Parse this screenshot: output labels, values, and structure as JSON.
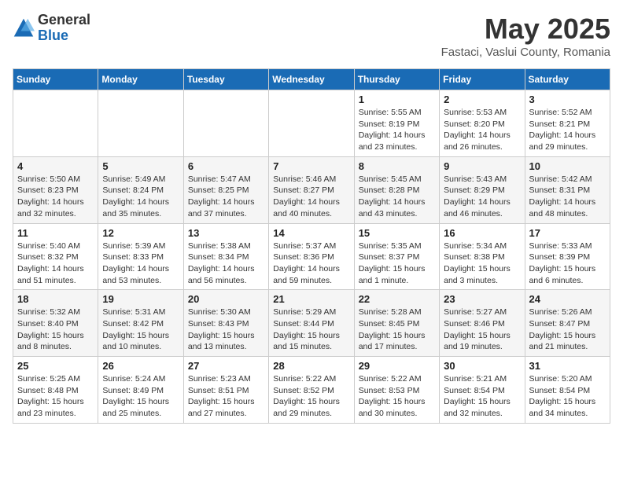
{
  "header": {
    "logo_general": "General",
    "logo_blue": "Blue",
    "month_title": "May 2025",
    "location": "Fastaci, Vaslui County, Romania"
  },
  "weekdays": [
    "Sunday",
    "Monday",
    "Tuesday",
    "Wednesday",
    "Thursday",
    "Friday",
    "Saturday"
  ],
  "weeks": [
    [
      {
        "num": "",
        "info": ""
      },
      {
        "num": "",
        "info": ""
      },
      {
        "num": "",
        "info": ""
      },
      {
        "num": "",
        "info": ""
      },
      {
        "num": "1",
        "info": "Sunrise: 5:55 AM\nSunset: 8:19 PM\nDaylight: 14 hours\nand 23 minutes."
      },
      {
        "num": "2",
        "info": "Sunrise: 5:53 AM\nSunset: 8:20 PM\nDaylight: 14 hours\nand 26 minutes."
      },
      {
        "num": "3",
        "info": "Sunrise: 5:52 AM\nSunset: 8:21 PM\nDaylight: 14 hours\nand 29 minutes."
      }
    ],
    [
      {
        "num": "4",
        "info": "Sunrise: 5:50 AM\nSunset: 8:23 PM\nDaylight: 14 hours\nand 32 minutes."
      },
      {
        "num": "5",
        "info": "Sunrise: 5:49 AM\nSunset: 8:24 PM\nDaylight: 14 hours\nand 35 minutes."
      },
      {
        "num": "6",
        "info": "Sunrise: 5:47 AM\nSunset: 8:25 PM\nDaylight: 14 hours\nand 37 minutes."
      },
      {
        "num": "7",
        "info": "Sunrise: 5:46 AM\nSunset: 8:27 PM\nDaylight: 14 hours\nand 40 minutes."
      },
      {
        "num": "8",
        "info": "Sunrise: 5:45 AM\nSunset: 8:28 PM\nDaylight: 14 hours\nand 43 minutes."
      },
      {
        "num": "9",
        "info": "Sunrise: 5:43 AM\nSunset: 8:29 PM\nDaylight: 14 hours\nand 46 minutes."
      },
      {
        "num": "10",
        "info": "Sunrise: 5:42 AM\nSunset: 8:31 PM\nDaylight: 14 hours\nand 48 minutes."
      }
    ],
    [
      {
        "num": "11",
        "info": "Sunrise: 5:40 AM\nSunset: 8:32 PM\nDaylight: 14 hours\nand 51 minutes."
      },
      {
        "num": "12",
        "info": "Sunrise: 5:39 AM\nSunset: 8:33 PM\nDaylight: 14 hours\nand 53 minutes."
      },
      {
        "num": "13",
        "info": "Sunrise: 5:38 AM\nSunset: 8:34 PM\nDaylight: 14 hours\nand 56 minutes."
      },
      {
        "num": "14",
        "info": "Sunrise: 5:37 AM\nSunset: 8:36 PM\nDaylight: 14 hours\nand 59 minutes."
      },
      {
        "num": "15",
        "info": "Sunrise: 5:35 AM\nSunset: 8:37 PM\nDaylight: 15 hours\nand 1 minute."
      },
      {
        "num": "16",
        "info": "Sunrise: 5:34 AM\nSunset: 8:38 PM\nDaylight: 15 hours\nand 3 minutes."
      },
      {
        "num": "17",
        "info": "Sunrise: 5:33 AM\nSunset: 8:39 PM\nDaylight: 15 hours\nand 6 minutes."
      }
    ],
    [
      {
        "num": "18",
        "info": "Sunrise: 5:32 AM\nSunset: 8:40 PM\nDaylight: 15 hours\nand 8 minutes."
      },
      {
        "num": "19",
        "info": "Sunrise: 5:31 AM\nSunset: 8:42 PM\nDaylight: 15 hours\nand 10 minutes."
      },
      {
        "num": "20",
        "info": "Sunrise: 5:30 AM\nSunset: 8:43 PM\nDaylight: 15 hours\nand 13 minutes."
      },
      {
        "num": "21",
        "info": "Sunrise: 5:29 AM\nSunset: 8:44 PM\nDaylight: 15 hours\nand 15 minutes."
      },
      {
        "num": "22",
        "info": "Sunrise: 5:28 AM\nSunset: 8:45 PM\nDaylight: 15 hours\nand 17 minutes."
      },
      {
        "num": "23",
        "info": "Sunrise: 5:27 AM\nSunset: 8:46 PM\nDaylight: 15 hours\nand 19 minutes."
      },
      {
        "num": "24",
        "info": "Sunrise: 5:26 AM\nSunset: 8:47 PM\nDaylight: 15 hours\nand 21 minutes."
      }
    ],
    [
      {
        "num": "25",
        "info": "Sunrise: 5:25 AM\nSunset: 8:48 PM\nDaylight: 15 hours\nand 23 minutes."
      },
      {
        "num": "26",
        "info": "Sunrise: 5:24 AM\nSunset: 8:49 PM\nDaylight: 15 hours\nand 25 minutes."
      },
      {
        "num": "27",
        "info": "Sunrise: 5:23 AM\nSunset: 8:51 PM\nDaylight: 15 hours\nand 27 minutes."
      },
      {
        "num": "28",
        "info": "Sunrise: 5:22 AM\nSunset: 8:52 PM\nDaylight: 15 hours\nand 29 minutes."
      },
      {
        "num": "29",
        "info": "Sunrise: 5:22 AM\nSunset: 8:53 PM\nDaylight: 15 hours\nand 30 minutes."
      },
      {
        "num": "30",
        "info": "Sunrise: 5:21 AM\nSunset: 8:54 PM\nDaylight: 15 hours\nand 32 minutes."
      },
      {
        "num": "31",
        "info": "Sunrise: 5:20 AM\nSunset: 8:54 PM\nDaylight: 15 hours\nand 34 minutes."
      }
    ]
  ]
}
